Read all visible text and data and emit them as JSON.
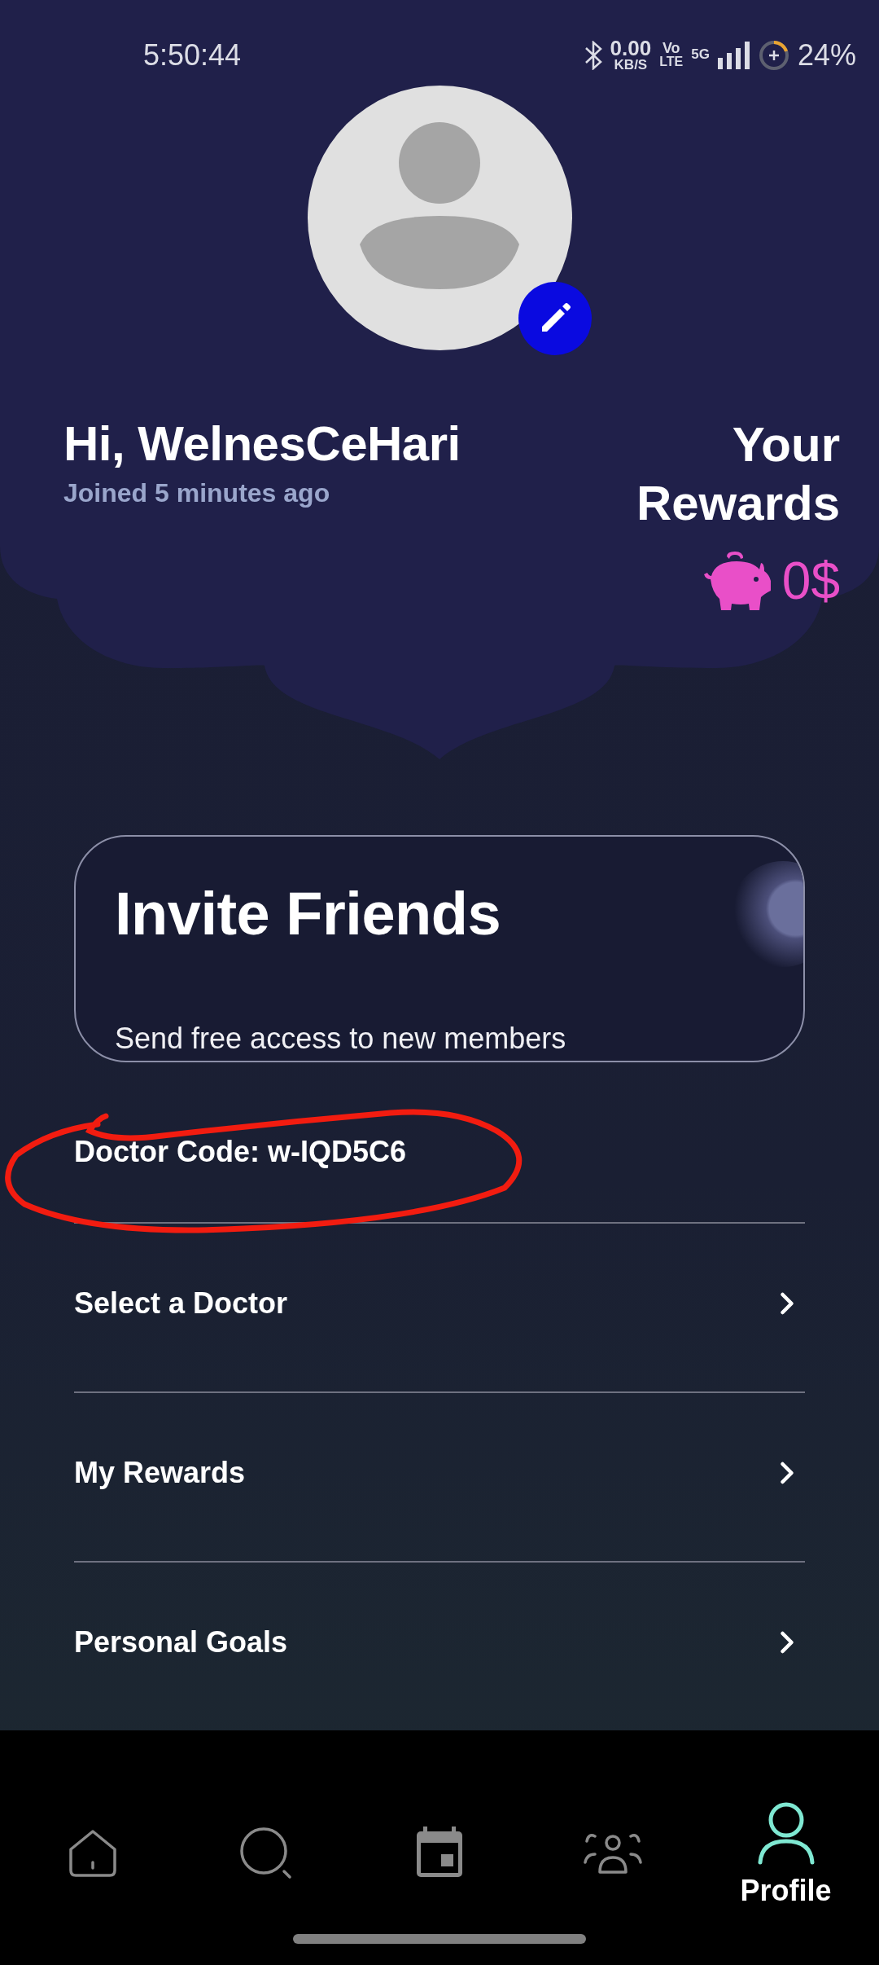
{
  "status_bar": {
    "time": "5:50:44",
    "net_speed": "0.00",
    "net_unit": "KB/S",
    "volte_top": "Vo",
    "volte_bottom": "LTE",
    "network": "5G",
    "battery": "24%"
  },
  "profile": {
    "greeting": "Hi, WelnesCeHari",
    "joined": "Joined 5 minutes ago",
    "rewards_title": "Your Rewards",
    "rewards_amount": "0$"
  },
  "invite_card": {
    "title": "Invite Friends",
    "subtitle": "Send free access to new members"
  },
  "doctor_code": "Doctor Code: w-IQD5C6",
  "menu": [
    {
      "label": "Select a Doctor"
    },
    {
      "label": "My Rewards"
    },
    {
      "label": "Personal Goals"
    }
  ],
  "nav": [
    {
      "kind": "home",
      "selected": false
    },
    {
      "kind": "search",
      "selected": false
    },
    {
      "kind": "calendar",
      "selected": false
    },
    {
      "kind": "people",
      "selected": false
    },
    {
      "kind": "profile",
      "selected": true,
      "label": "Profile"
    }
  ]
}
